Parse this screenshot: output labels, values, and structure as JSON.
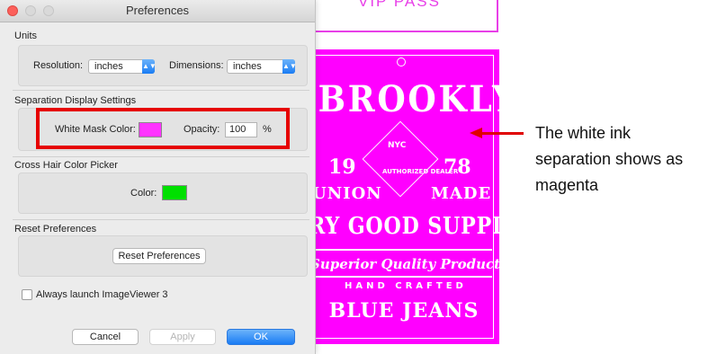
{
  "window": {
    "title": "Preferences"
  },
  "units": {
    "section_label": "Units",
    "resolution_label": "Resolution:",
    "resolution_value": "inches",
    "dimensions_label": "Dimensions:",
    "dimensions_value": "inches"
  },
  "separation": {
    "section_label": "Separation Display Settings",
    "white_mask_label": "White Mask Color:",
    "white_mask_color": "#ff33ff",
    "opacity_label": "Opacity:",
    "opacity_value": "100",
    "opacity_unit": "%"
  },
  "crosshair": {
    "section_label": "Cross Hair Color Picker",
    "color_label": "Color:",
    "color": "#00e000"
  },
  "reset": {
    "section_label": "Reset Preferences",
    "button_label": "Reset Preferences"
  },
  "launch": {
    "checkbox_label": "Always launch ImageViewer 3",
    "checked": false
  },
  "buttons": {
    "cancel": "Cancel",
    "apply": "Apply",
    "ok": "OK"
  },
  "annotation": {
    "caption": "The white ink separation shows as magenta"
  },
  "artwork": {
    "top_text": "VIP PASS",
    "brooklyn": "BROOKLYN",
    "nyc": "NYC",
    "year_left": "19",
    "year_right": "78",
    "dealer": "AUTHORIZED DEALER",
    "union": "UNION",
    "made": "MADE",
    "supply": "RY GOOD SUPPLY",
    "quality": "Superior Quality Product",
    "hand": "HAND CRAFTED",
    "jeans": "BLUE JEANS"
  },
  "colors": {
    "accent_blue": "#1a7cf4",
    "highlight_red": "#e60000",
    "magenta": "#ff00ff"
  }
}
